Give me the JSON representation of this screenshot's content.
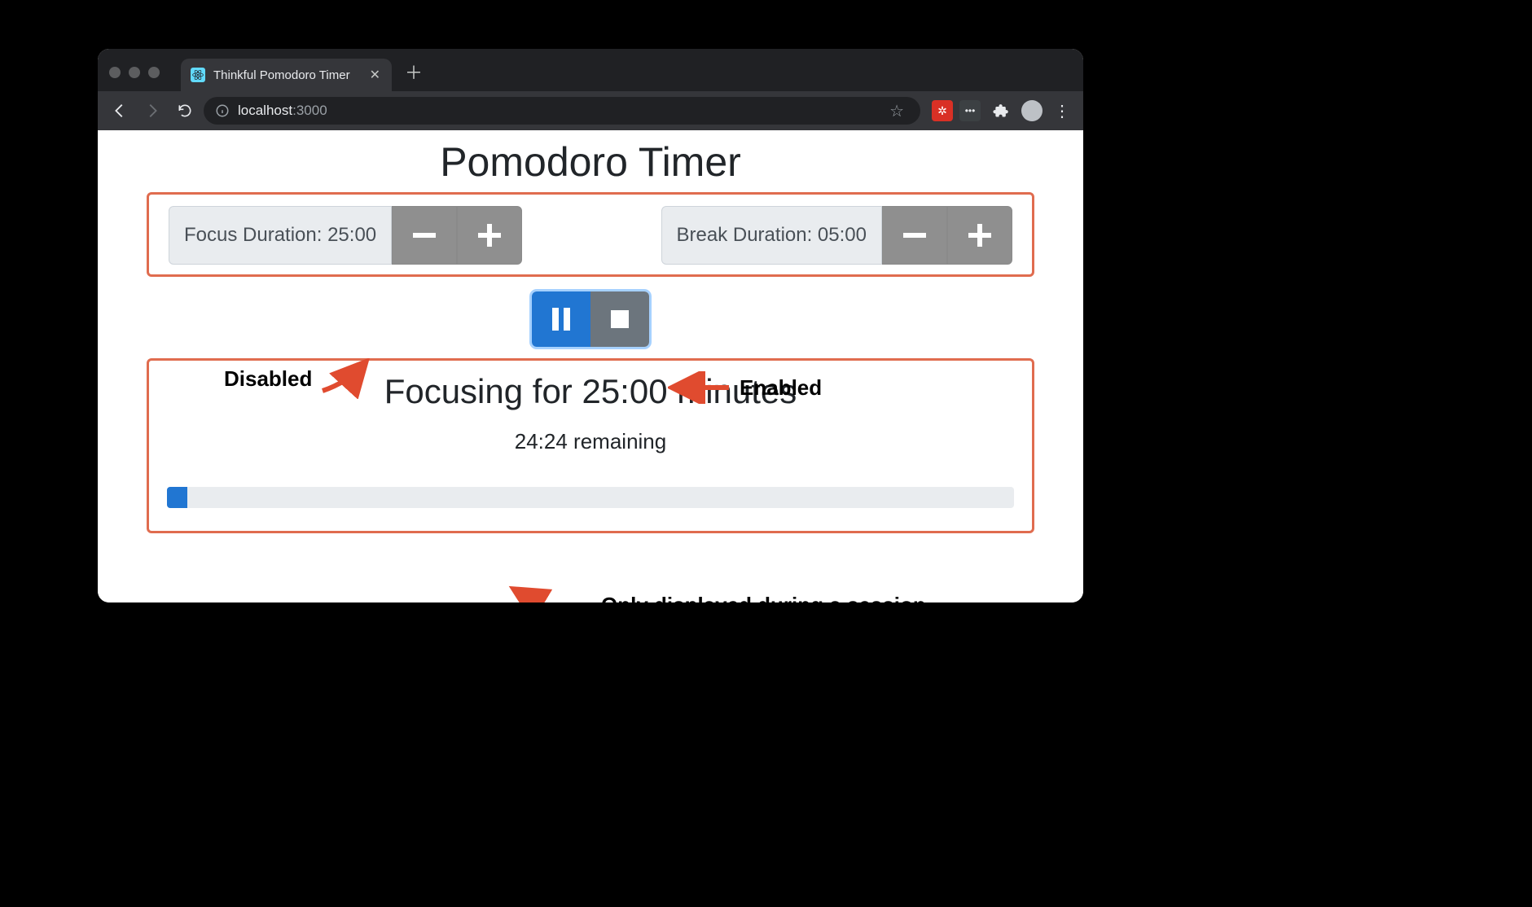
{
  "browser": {
    "tab_title": "Thinkful Pomodoro Timer",
    "url_host": "localhost",
    "url_port": ":3000"
  },
  "header": {
    "title": "Pomodoro Timer"
  },
  "focus": {
    "label": "Focus Duration: 25:00"
  },
  "break": {
    "label": "Break Duration: 05:00"
  },
  "session": {
    "title": "Focusing for 25:00 minutes",
    "remaining": "24:24 remaining",
    "progress_percent": 2.4
  },
  "annotations": {
    "disabled": "Disabled",
    "enabled": "Enabled",
    "session_only": "Only displayed during a session"
  },
  "colors": {
    "highlight_border": "#e06c4f",
    "primary": "#2176d2",
    "secondary": "#6c757d"
  }
}
